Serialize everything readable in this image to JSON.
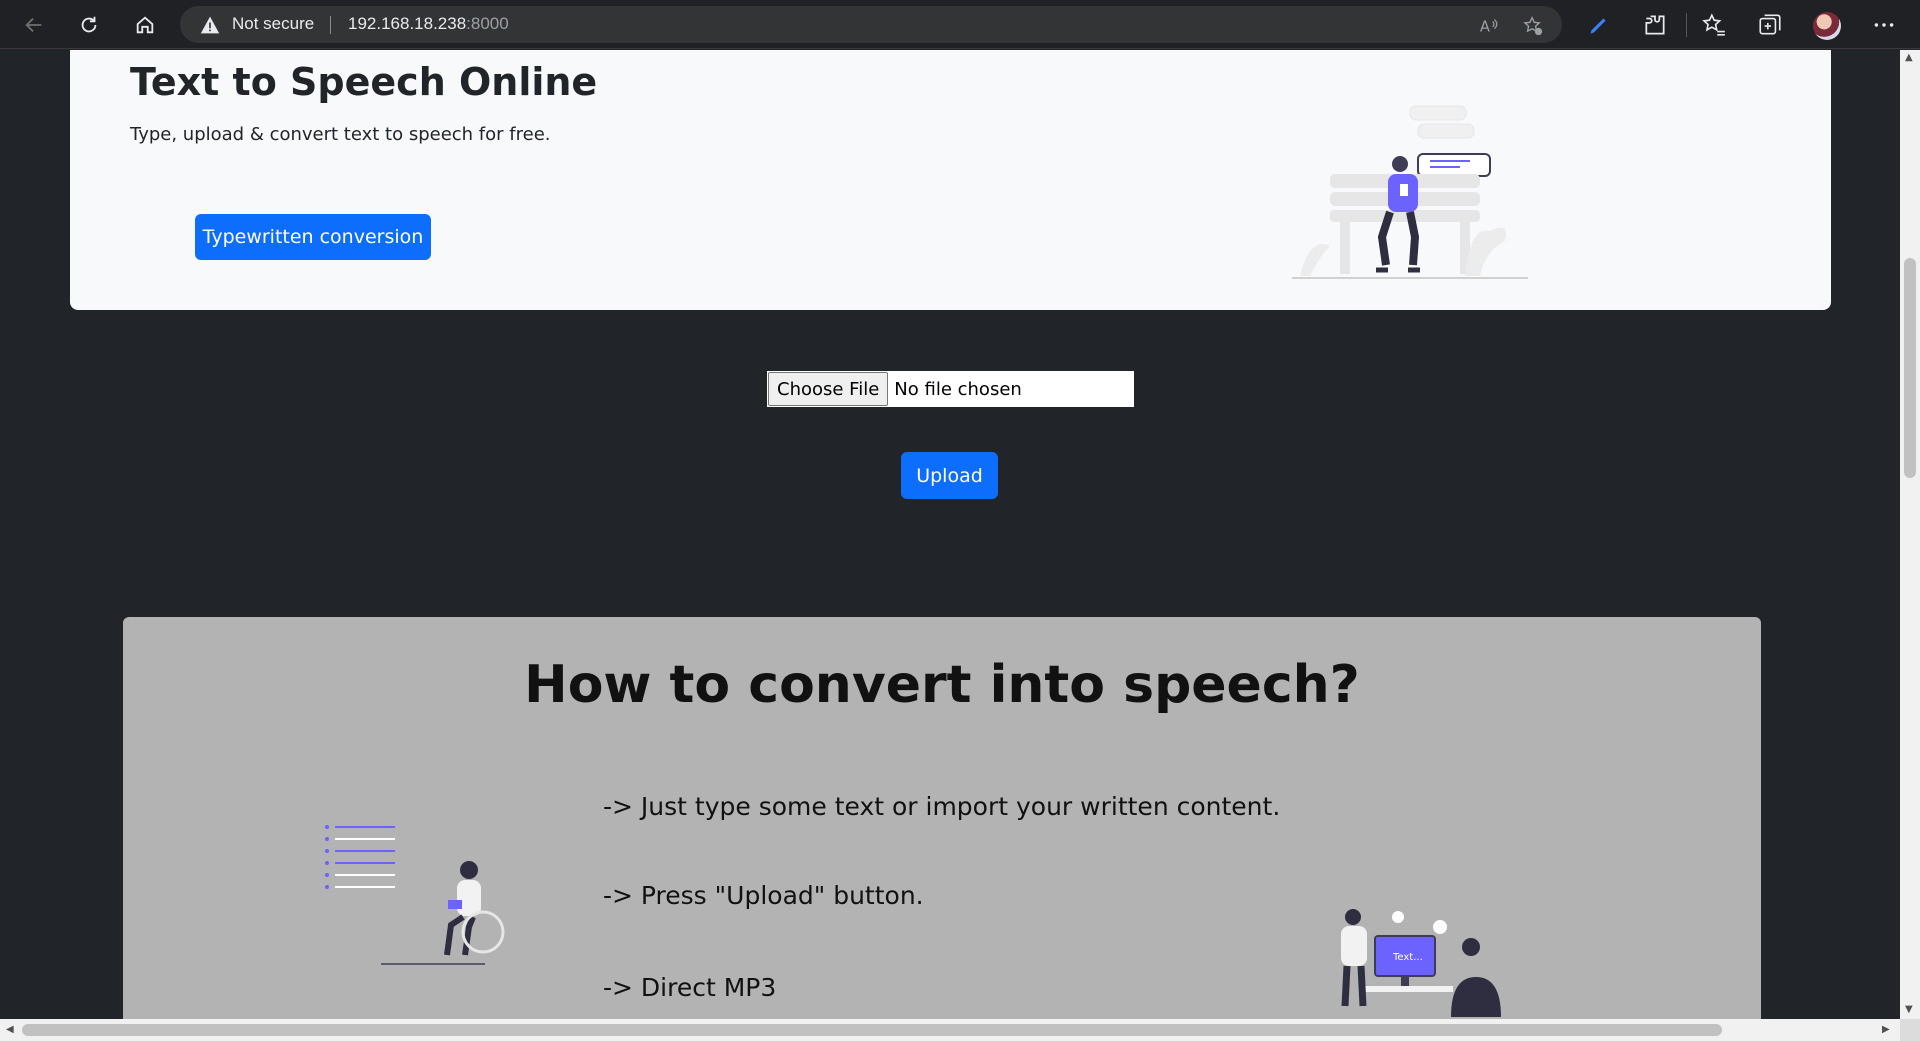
{
  "browser": {
    "security_label": "Not secure",
    "url_host": "192.168.18.238",
    "url_port": ":8000",
    "icons": {
      "back": "back-arrow-icon",
      "refresh": "refresh-icon",
      "home": "home-icon",
      "warning": "warning-icon",
      "read_aloud": "read-aloud-icon",
      "favorite": "add-favorite-icon",
      "extension_pen": "pen-extension-icon",
      "extensions": "puzzle-icon",
      "favorites": "favorites-icon",
      "collections": "collections-icon",
      "profile": "avatar",
      "menu": "more-icon"
    }
  },
  "hero": {
    "title": "Text to Speech Online",
    "subtitle": "Type, upload & convert text to speech for free.",
    "typewritten_button": "Typewritten conversion"
  },
  "upload": {
    "choose_file_label": "Choose File",
    "file_status": "No file chosen",
    "upload_button": "Upload"
  },
  "howto": {
    "title": "How to convert into speech?",
    "steps": [
      "-> Just type some text or import your written content.",
      "-> Press \"Upload\" button.",
      "-> Direct MP3"
    ],
    "illustration_text": "Text..."
  },
  "colors": {
    "page_bg": "#212529",
    "hero_bg": "#f8f9fa",
    "accent": "#0d6efd",
    "howto_bg": "#b3b3b3",
    "illustration_purple": "#6c63ff"
  }
}
